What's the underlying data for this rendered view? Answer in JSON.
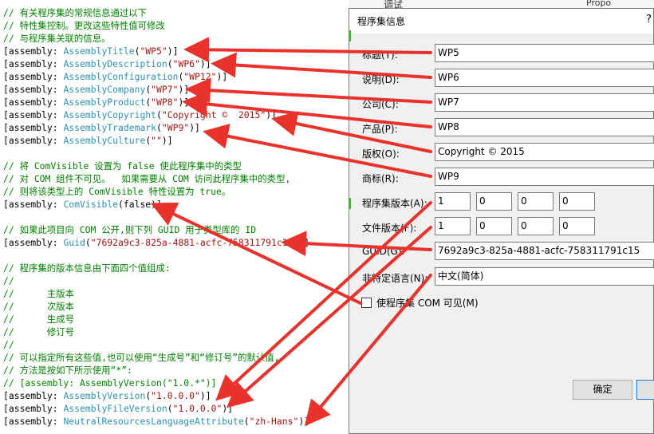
{
  "editor": {
    "lines": [
      [
        {
          "t": "// 有关程序集的常规信息通过以下",
          "c": "cm"
        }
      ],
      [
        {
          "t": "// 特性集控制。更改这些特性值可修改",
          "c": "cm"
        }
      ],
      [
        {
          "t": "// 与程序集关联的信息。",
          "c": "cm"
        }
      ],
      [
        {
          "t": "[assembly: ",
          "c": "kw"
        },
        {
          "t": "AssemblyTitle",
          "c": "ty"
        },
        {
          "t": "(",
          "c": "kw"
        },
        {
          "t": "\"WP5\"",
          "c": "st"
        },
        {
          "t": ")]",
          "c": "kw"
        }
      ],
      [
        {
          "t": "[assembly: ",
          "c": "kw"
        },
        {
          "t": "AssemblyDescription",
          "c": "ty"
        },
        {
          "t": "(",
          "c": "kw"
        },
        {
          "t": "\"WP6\"",
          "c": "st"
        },
        {
          "t": ")]",
          "c": "kw"
        }
      ],
      [
        {
          "t": "[assembly: ",
          "c": "kw"
        },
        {
          "t": "AssemblyConfiguration",
          "c": "ty"
        },
        {
          "t": "(",
          "c": "kw"
        },
        {
          "t": "\"WP12\"",
          "c": "st"
        },
        {
          "t": ")]",
          "c": "kw"
        }
      ],
      [
        {
          "t": "[assembly: ",
          "c": "kw"
        },
        {
          "t": "AssemblyCompany",
          "c": "ty"
        },
        {
          "t": "(",
          "c": "kw"
        },
        {
          "t": "\"WP7\"",
          "c": "st"
        },
        {
          "t": ")]",
          "c": "kw"
        }
      ],
      [
        {
          "t": "[assembly: ",
          "c": "kw"
        },
        {
          "t": "AssemblyProduct",
          "c": "ty"
        },
        {
          "t": "(",
          "c": "kw"
        },
        {
          "t": "\"WP8\"",
          "c": "st"
        },
        {
          "t": ")]",
          "c": "kw"
        }
      ],
      [
        {
          "t": "[assembly: ",
          "c": "kw"
        },
        {
          "t": "AssemblyCopyright",
          "c": "ty"
        },
        {
          "t": "(",
          "c": "kw"
        },
        {
          "t": "\"Copyright ©  2015\"",
          "c": "st"
        },
        {
          "t": ")]",
          "c": "kw"
        }
      ],
      [
        {
          "t": "[assembly: ",
          "c": "kw"
        },
        {
          "t": "AssemblyTrademark",
          "c": "ty"
        },
        {
          "t": "(",
          "c": "kw"
        },
        {
          "t": "\"WP9\"",
          "c": "st"
        },
        {
          "t": ")]",
          "c": "kw"
        }
      ],
      [
        {
          "t": "[assembly: ",
          "c": "kw"
        },
        {
          "t": "AssemblyCulture",
          "c": "ty"
        },
        {
          "t": "(",
          "c": "kw"
        },
        {
          "t": "\"\"",
          "c": "st"
        },
        {
          "t": ")]",
          "c": "kw"
        }
      ],
      [],
      [
        {
          "t": "// 将 ComVisible 设置为 false 使此程序集中的类型",
          "c": "cm"
        }
      ],
      [
        {
          "t": "// 对 COM 组件不可见。  如果需要从 COM 访问此程序集中的类型,",
          "c": "cm"
        }
      ],
      [
        {
          "t": "// 则将该类型上的 ComVisible 特性设置为 true。",
          "c": "cm"
        }
      ],
      [
        {
          "t": "[assembly: ",
          "c": "kw"
        },
        {
          "t": "ComVisible",
          "c": "ty"
        },
        {
          "t": "(false)]",
          "c": "kw"
        }
      ],
      [],
      [
        {
          "t": "// 如果此项目向 COM 公开,则下列 GUID 用于类型库的 ID",
          "c": "cm"
        }
      ],
      [
        {
          "t": "[assembly: ",
          "c": "kw"
        },
        {
          "t": "Guid",
          "c": "ty"
        },
        {
          "t": "(",
          "c": "kw"
        },
        {
          "t": "\"7692a9c3-825a-4881-acfc-758311791c15\"",
          "c": "st"
        },
        {
          "t": ")]",
          "c": "kw"
        }
      ],
      [],
      [
        {
          "t": "// 程序集的版本信息由下面四个值组成:",
          "c": "cm"
        }
      ],
      [
        {
          "t": "//",
          "c": "cm"
        }
      ],
      [
        {
          "t": "//      主版本",
          "c": "cm"
        }
      ],
      [
        {
          "t": "//      次版本",
          "c": "cm"
        }
      ],
      [
        {
          "t": "//      生成号",
          "c": "cm"
        }
      ],
      [
        {
          "t": "//      修订号",
          "c": "cm"
        }
      ],
      [
        {
          "t": "//",
          "c": "cm"
        }
      ],
      [
        {
          "t": "// 可以指定所有这些值,也可以使用“生成号”和“修订号”的默认值,",
          "c": "cm"
        }
      ],
      [
        {
          "t": "// 方法是按如下所示使用“*”:",
          "c": "cm"
        }
      ],
      [
        {
          "t": "// [assembly: AssemblyVersion(\"1.0.*\")]",
          "c": "cm"
        }
      ],
      [
        {
          "t": "[assembly: ",
          "c": "kw"
        },
        {
          "t": "AssemblyVersion",
          "c": "ty"
        },
        {
          "t": "(",
          "c": "kw"
        },
        {
          "t": "\"1.0.0.0\"",
          "c": "st"
        },
        {
          "t": ")]",
          "c": "kw"
        }
      ],
      [
        {
          "t": "[assembly: ",
          "c": "kw"
        },
        {
          "t": "AssemblyFileVersion",
          "c": "ty"
        },
        {
          "t": "(",
          "c": "kw"
        },
        {
          "t": "\"1.0.0.0\"",
          "c": "st"
        },
        {
          "t": ")]",
          "c": "kw"
        }
      ],
      [
        {
          "t": "[assembly: ",
          "c": "kw"
        },
        {
          "t": "NeutralResourcesLanguageAttribute",
          "c": "ty"
        },
        {
          "t": "(",
          "c": "kw"
        },
        {
          "t": "\"zh-Hans\"",
          "c": "st"
        },
        {
          "t": ")]",
          "c": "kw"
        }
      ]
    ]
  },
  "background": {
    "menu_label": "调试",
    "right_label": "Propo"
  },
  "dialog": {
    "title": "程序集信息",
    "help_glyph": "?",
    "fields": {
      "title": {
        "label": "标题(T):",
        "value": "WP5"
      },
      "description": {
        "label": "说明(D):",
        "value": "WP6"
      },
      "company": {
        "label": "公司(C):",
        "value": "WP7"
      },
      "product": {
        "label": "产品(P):",
        "value": "WP8"
      },
      "copyright": {
        "label": "版权(O):",
        "value": "Copyright ©  2015"
      },
      "trademark": {
        "label": "商标(R):",
        "value": "WP9"
      },
      "guid": {
        "label": "GUID(G):",
        "value": "7692a9c3-825a-4881-acfc-758311791c15"
      },
      "neutral_language": {
        "label": "非特定语言(N):",
        "value": "中文(简体)"
      }
    },
    "assembly_version": {
      "label": "程序集版本(A):",
      "parts": [
        "1",
        "0",
        "0",
        "0"
      ]
    },
    "file_version": {
      "label": "文件版本(F):",
      "parts": [
        "1",
        "0",
        "0",
        "0"
      ]
    },
    "com_visible": {
      "label": "使程序集 COM 可见(M)",
      "checked": false
    },
    "ok_label": "确定"
  },
  "colors": {
    "comment": "#008000",
    "type": "#2b91af",
    "string": "#a31515",
    "arrow": "#e8322b"
  }
}
